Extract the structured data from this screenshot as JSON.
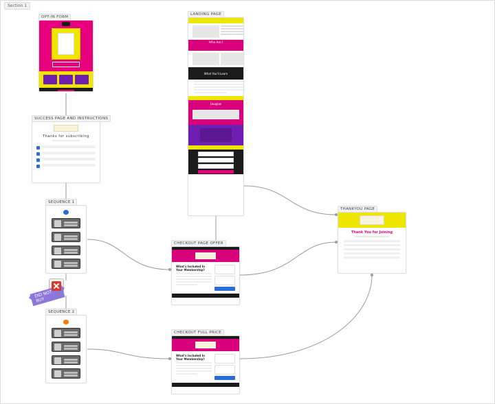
{
  "section_tab": "Section 1",
  "nodes": {
    "optin": {
      "label": "OPT-IN FORM"
    },
    "success": {
      "label": "SUCCESS PAGE AND INSTRUCTIONS",
      "title": "Thanks for subscribing"
    },
    "seq1": {
      "label": "SEQUENCE 1"
    },
    "seq2": {
      "label": "SEQUENCE 2"
    },
    "landing": {
      "label": "Landing page",
      "who": "Who Am I",
      "what": "What You'll Learn",
      "imagine": "Imagine"
    },
    "checkout_offer": {
      "label": "CHECKOUT PAGE OFFER",
      "heading": "What's Included In Your Membership?"
    },
    "checkout_full": {
      "label": "CHECKOUT FULL PRICE",
      "heading": "What's Included In Your Membership?"
    },
    "thankyou": {
      "label": "THANKYOU PAGE",
      "heading": "Thank You for Joining"
    }
  },
  "fail_tag": "DID NOT BUY",
  "colors": {
    "pink": "#e6007e",
    "yellow": "#efe600",
    "purple": "#6e1eb0",
    "dark": "#1b1b1b",
    "wire": "#9a9a9a"
  }
}
